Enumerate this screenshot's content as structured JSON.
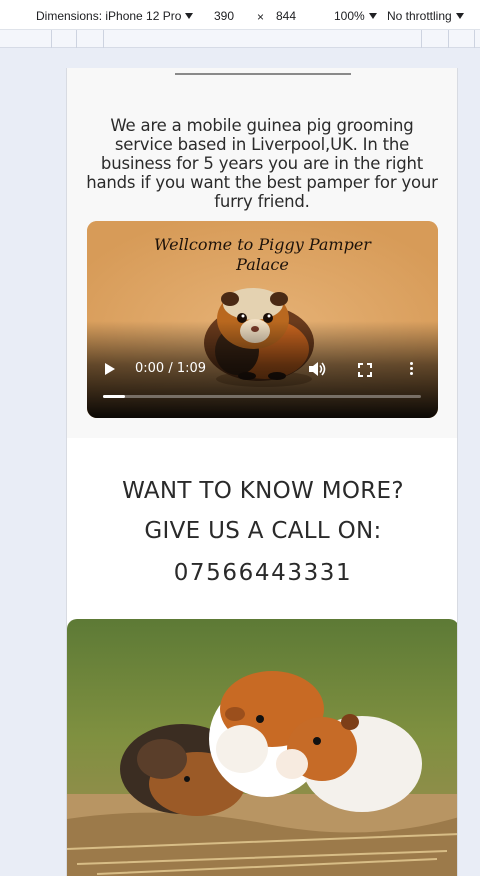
{
  "devtools": {
    "dimensions_label": "Dimensions: iPhone 12 Pro",
    "width": "390",
    "times": "×",
    "height": "844",
    "zoom": "100%",
    "throttling": "No throttling"
  },
  "page": {
    "intro": "We are a mobile guinea pig grooming service based in Liverpool,UK. In the business for 5 years you are in the right hands if you want the best pamper for your furry friend.",
    "video": {
      "title_line1": "Wellcome to Piggy Pamper",
      "title_line2": "Palace",
      "time": "0:00 / 1:09",
      "progress": 0.07
    },
    "contact": {
      "line1": "WANT TO KNOW MORE?",
      "line2": "GIVE US A CALL ON:",
      "phone": "07566443331"
    }
  },
  "icons": {
    "play": "play-icon",
    "volume": "volume-icon",
    "fullscreen": "fullscreen-icon",
    "more": "more-vertical-icon"
  }
}
